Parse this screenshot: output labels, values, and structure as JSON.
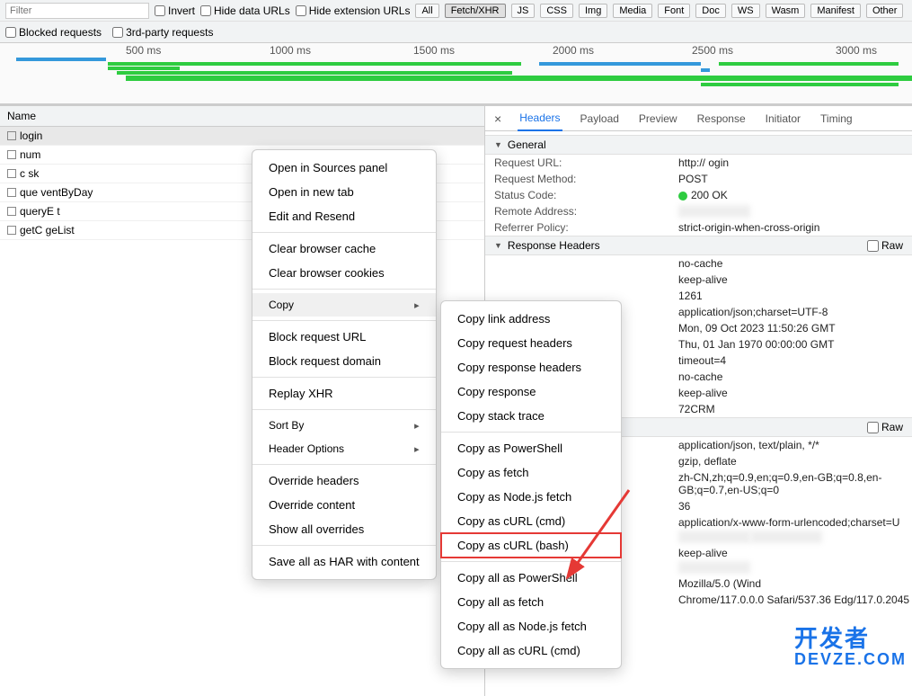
{
  "toolbar": {
    "filter_placeholder": "Filter",
    "invert": "Invert",
    "hide_data_urls": "Hide data URLs",
    "hide_ext_urls": "Hide extension URLs",
    "types": [
      "All",
      "Fetch/XHR",
      "JS",
      "CSS",
      "Img",
      "Media",
      "Font",
      "Doc",
      "WS",
      "Wasm",
      "Manifest",
      "Other"
    ],
    "active_type": "Fetch/XHR",
    "blocked_requests": "Blocked requests",
    "third_party": "3rd-party requests"
  },
  "timeline": {
    "labels": [
      "500 ms",
      "1000 ms",
      "1500 ms",
      "2000 ms",
      "2500 ms",
      "3000 ms"
    ]
  },
  "reqlist": {
    "header": "Name",
    "rows": [
      {
        "name": "login",
        "selected": true
      },
      {
        "name": "num"
      },
      {
        "name": "c            sk",
        "blur": true
      },
      {
        "name": "que    ventByDay",
        "blur": true
      },
      {
        "name": "queryE     t",
        "blur": true
      },
      {
        "name": "getC              geList",
        "blur": true
      }
    ]
  },
  "ctx_menu": {
    "open_sources": "Open in Sources panel",
    "open_new_tab": "Open in new tab",
    "edit_resend": "Edit and Resend",
    "clear_cache": "Clear browser cache",
    "clear_cookies": "Clear browser cookies",
    "copy": "Copy",
    "block_url": "Block request URL",
    "block_domain": "Block request domain",
    "replay_xhr": "Replay XHR",
    "sort_by": "Sort By",
    "header_options": "Header Options",
    "override_headers": "Override headers",
    "override_content": "Override content",
    "show_all_overrides": "Show all overrides",
    "save_all_har": "Save all as HAR with content"
  },
  "copy_submenu": [
    "Copy link address",
    "Copy request headers",
    "Copy response headers",
    "Copy response",
    "Copy stack trace",
    "Copy as PowerShell",
    "Copy as fetch",
    "Copy as Node.js fetch",
    "Copy as cURL (cmd)",
    "Copy as cURL (bash)",
    "Copy all as PowerShell",
    "Copy all as fetch",
    "Copy all as Node.js fetch",
    "Copy all as cURL (cmd)"
  ],
  "details": {
    "tabs": [
      "Headers",
      "Payload",
      "Preview",
      "Response",
      "Initiator",
      "Timing"
    ],
    "active_tab": "Headers",
    "sections": {
      "general": "General",
      "response_headers": "Response Headers",
      "raw_label": "Raw"
    },
    "general": {
      "request_url_k": "Request URL:",
      "request_url_v": "http://                                 ogin",
      "request_method_k": "Request Method:",
      "request_method_v": "POST",
      "status_code_k": "Status Code:",
      "status_code_v": "200 OK",
      "remote_address_k": "Remote Address:",
      "remote_address_v": "",
      "referrer_policy_k": "Referrer Policy:",
      "referrer_policy_v": "strict-origin-when-cross-origin"
    },
    "response_headers_values": [
      "no-cache",
      "keep-alive",
      "1261",
      "application/json;charset=UTF-8",
      "Mon, 09 Oct 2023 11:50:26 GMT",
      "Thu, 01 Jan 1970 00:00:00 GMT",
      "timeout=4",
      "no-cache",
      "keep-alive",
      "72CRM"
    ],
    "request_headers_values": [
      "application/json, text/plain, */*",
      "gzip, deflate",
      "zh-CN,zh;q=0.9,en;q=0.9,en-GB;q=0.8,en-GB;q=0.7,en-US;q=0",
      "36",
      "application/x-www-form-urlencoded;charset=U",
      "",
      "",
      "keep-alive",
      "",
      "Mozilla/5.0 (Wind",
      "Chrome/117.0.0.0 Safari/537.36 Edg/117.0.2045"
    ]
  },
  "watermark": {
    "cn": "开发者",
    "en": "DEVZE.COM"
  }
}
